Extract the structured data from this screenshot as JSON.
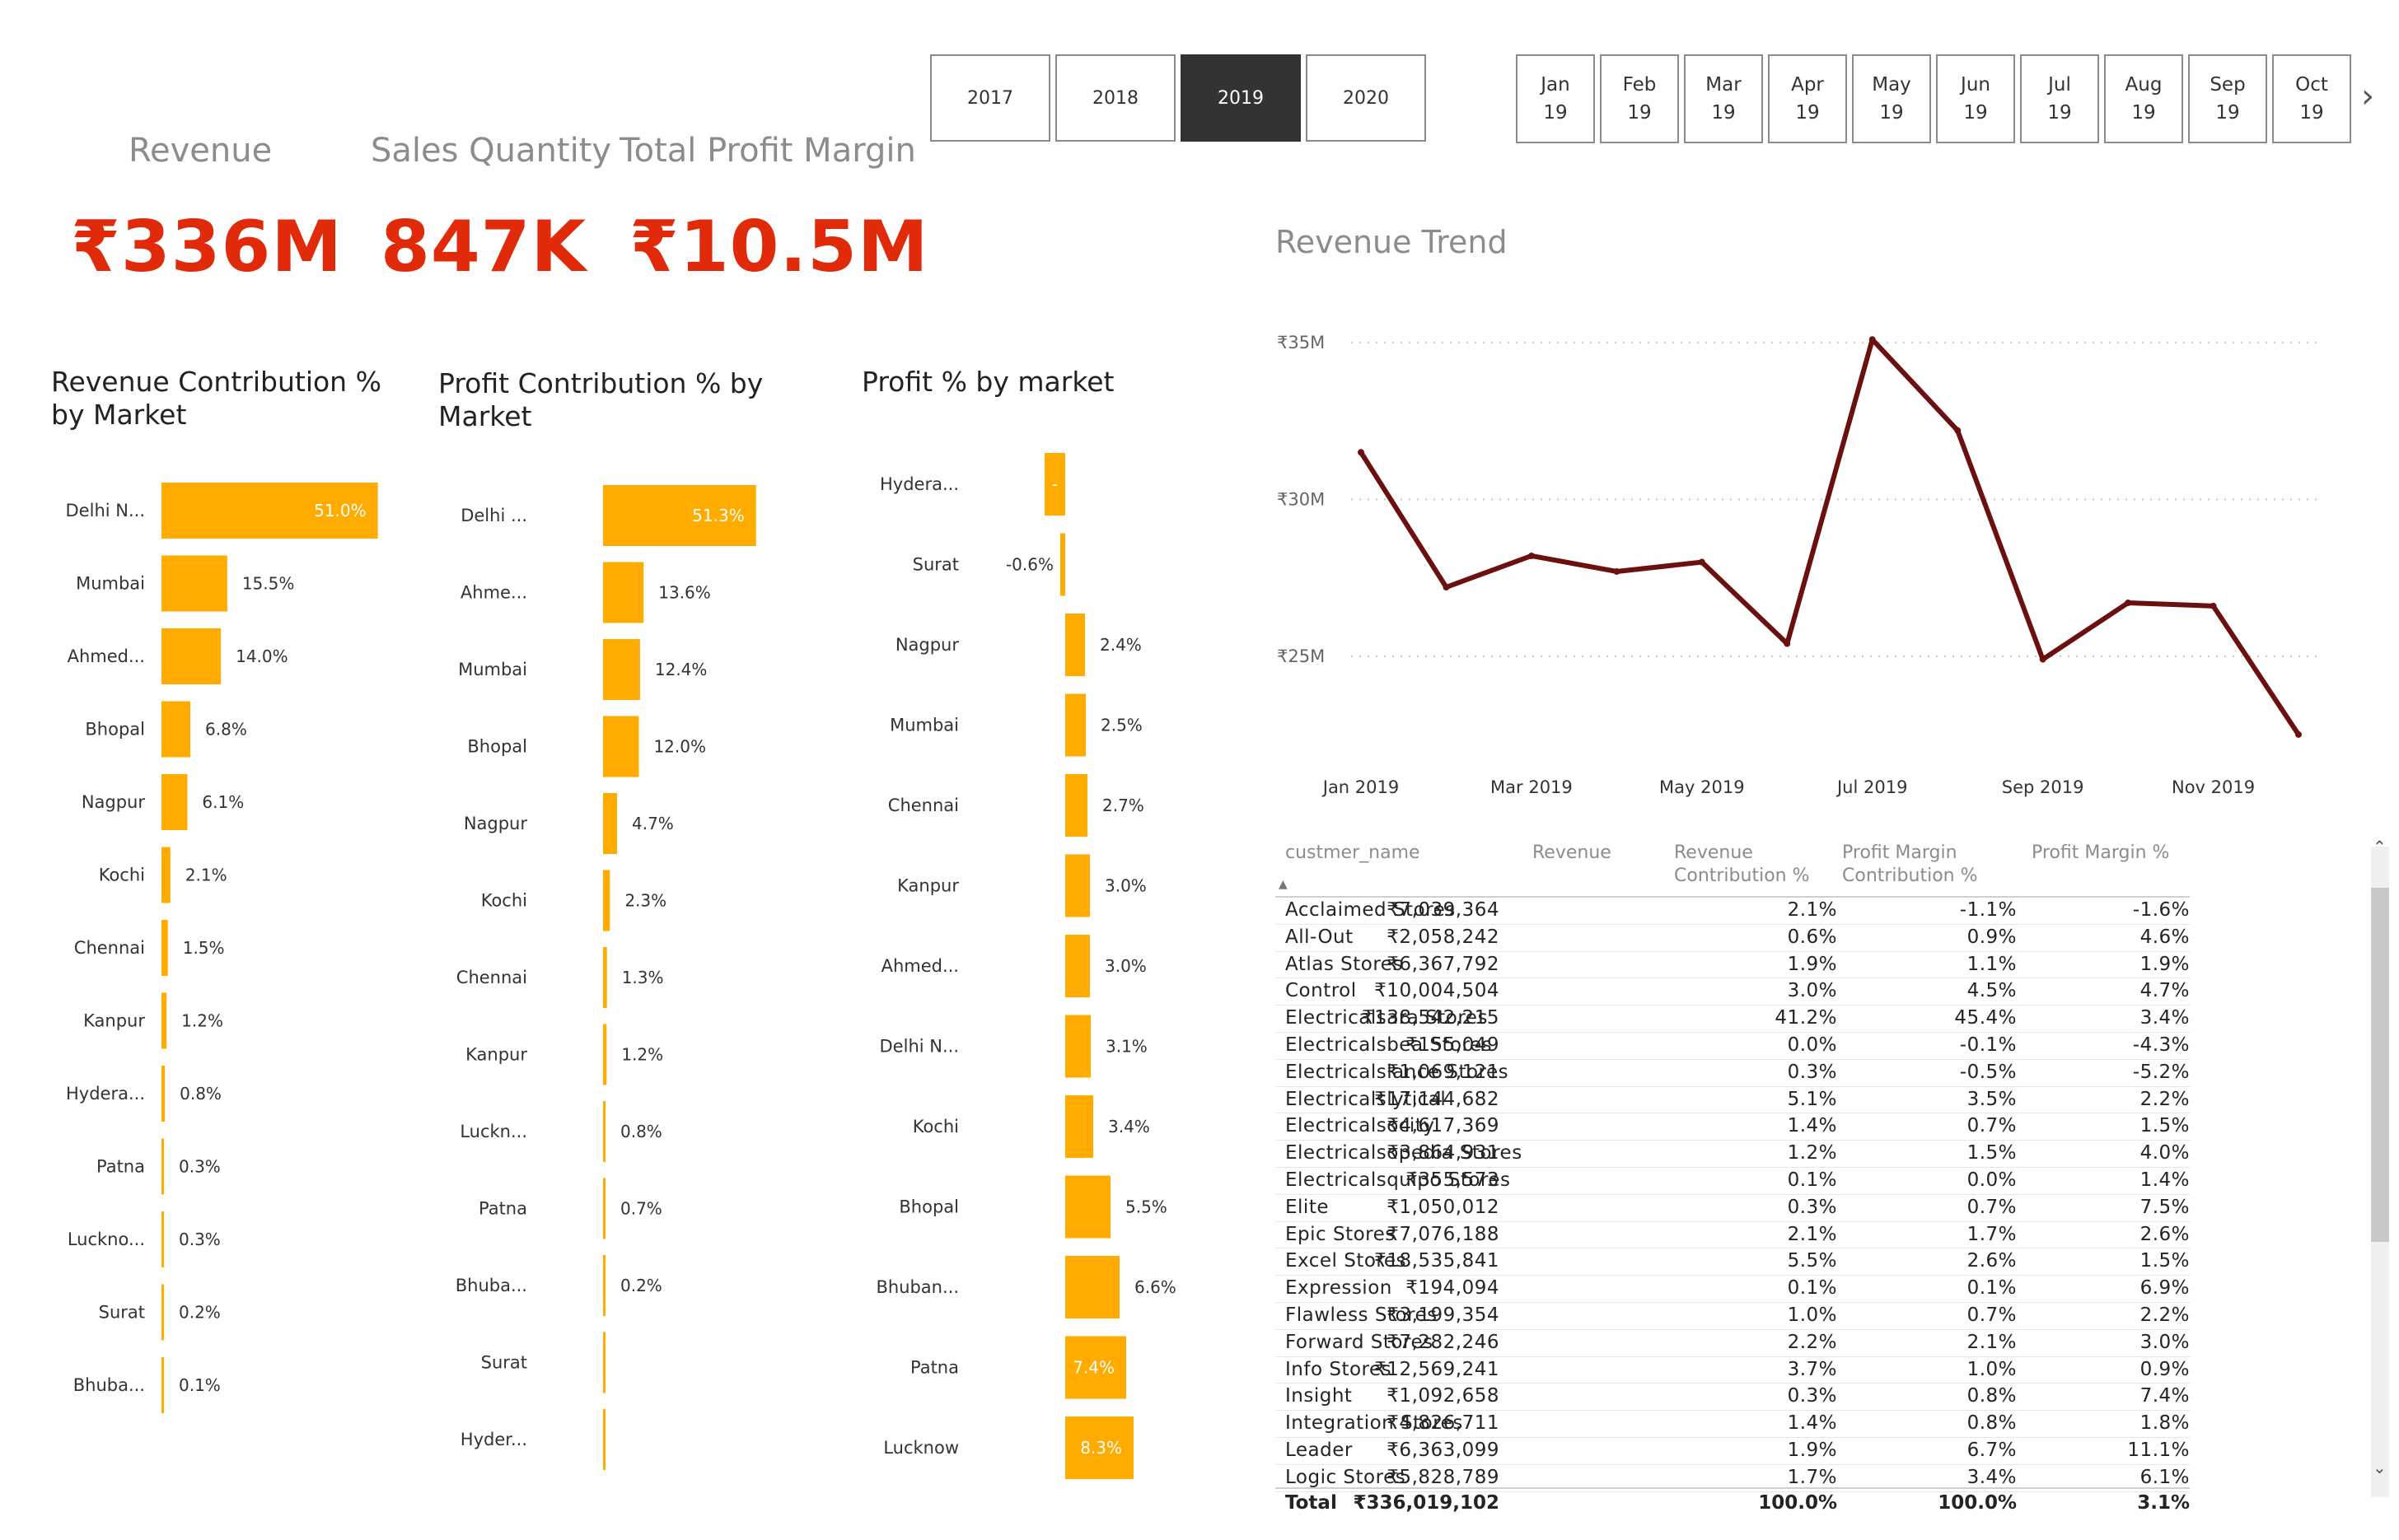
{
  "years": [
    {
      "label": "2017",
      "selected": false
    },
    {
      "label": "2018",
      "selected": false
    },
    {
      "label": "2019",
      "selected": true
    },
    {
      "label": "2020",
      "selected": false
    }
  ],
  "months": [
    {
      "m": "Jan",
      "y": "19"
    },
    {
      "m": "Feb",
      "y": "19"
    },
    {
      "m": "Mar",
      "y": "19"
    },
    {
      "m": "Apr",
      "y": "19"
    },
    {
      "m": "May",
      "y": "19"
    },
    {
      "m": "Jun",
      "y": "19"
    },
    {
      "m": "Jul",
      "y": "19"
    },
    {
      "m": "Aug",
      "y": "19"
    },
    {
      "m": "Sep",
      "y": "19"
    },
    {
      "m": "Oct",
      "y": "19"
    }
  ],
  "kpis": {
    "revenue_label": "Revenue",
    "revenue_value": "₹336M",
    "qty_label": "Sales Quantity",
    "qty_value": "847K",
    "margin_label": "Total Profit Margin",
    "margin_value": "₹10.5M"
  },
  "colors": {
    "bar": "#ffab00",
    "kpi": "#e12a0a",
    "trend": "#6b0f0f",
    "selected_year": "#333333"
  },
  "chart_data": [
    {
      "type": "bar",
      "orientation": "horizontal",
      "title": "Revenue Contribution % by Market",
      "categories": [
        "Delhi N...",
        "Mumbai",
        "Ahmed...",
        "Bhopal",
        "Nagpur",
        "Kochi",
        "Chennai",
        "Kanpur",
        "Hydera...",
        "Patna",
        "Luckno...",
        "Surat",
        "Bhuba..."
      ],
      "values": [
        51.0,
        15.5,
        14.0,
        6.8,
        6.1,
        2.1,
        1.5,
        1.2,
        0.8,
        0.3,
        0.3,
        0.2,
        0.1
      ],
      "labels": [
        "51.0%",
        "15.5%",
        "14.0%",
        "6.8%",
        "6.1%",
        "2.1%",
        "1.5%",
        "1.2%",
        "0.8%",
        "0.3%",
        "0.3%",
        "0.2%",
        "0.1%"
      ]
    },
    {
      "type": "bar",
      "orientation": "horizontal",
      "title": "Profit Contribution % by Market",
      "categories": [
        "Delhi ...",
        "Ahme...",
        "Mumbai",
        "Bhopal",
        "Nagpur",
        "Kochi",
        "Chennai",
        "Kanpur",
        "Luckn...",
        "Patna",
        "Bhuba...",
        "Surat",
        "Hyder..."
      ],
      "values": [
        51.3,
        13.6,
        12.4,
        12.0,
        4.7,
        2.3,
        1.3,
        1.2,
        0.8,
        0.7,
        0.2,
        0.0,
        0.0
      ],
      "labels": [
        "51.3%",
        "13.6%",
        "12.4%",
        "12.0%",
        "4.7%",
        "2.3%",
        "1.3%",
        "1.2%",
        "0.8%",
        "0.7%",
        "0.2%",
        "",
        ""
      ]
    },
    {
      "type": "bar",
      "orientation": "horizontal",
      "title": "Profit % by market",
      "categories": [
        "Hydera...",
        "Surat",
        "Nagpur",
        "Mumbai",
        "Chennai",
        "Kanpur",
        "Ahmed...",
        "Delhi N...",
        "Kochi",
        "Bhopal",
        "Bhuban...",
        "Patna",
        "Lucknow"
      ],
      "values": [
        -2.5,
        -0.6,
        2.4,
        2.5,
        2.7,
        3.0,
        3.0,
        3.1,
        3.4,
        5.5,
        6.6,
        7.4,
        8.3
      ],
      "labels": [
        "-",
        "-0.6%",
        "2.4%",
        "2.5%",
        "2.7%",
        "3.0%",
        "3.0%",
        "3.1%",
        "3.4%",
        "5.5%",
        "6.6%",
        "7.4%",
        "8.3%"
      ]
    },
    {
      "type": "line",
      "title": "Revenue Trend",
      "x": [
        "Jan 2019",
        "Feb 2019",
        "Mar 2019",
        "Apr 2019",
        "May 2019",
        "Jun 2019",
        "Jul 2019",
        "Aug 2019",
        "Sep 2019",
        "Oct 2019",
        "Nov 2019",
        "Dec 2019"
      ],
      "values": [
        31.5,
        27.2,
        28.2,
        27.7,
        28.0,
        25.4,
        35.1,
        32.2,
        24.9,
        26.7,
        26.6,
        22.5
      ],
      "unit": "₹M",
      "ylim": [
        21.5,
        36
      ],
      "yticks": [
        "₹25M",
        "₹30M",
        "₹35M"
      ],
      "ytick_values": [
        25,
        30,
        35
      ],
      "xticks": [
        "Jan 2019",
        "Mar 2019",
        "May 2019",
        "Jul 2019",
        "Sep 2019",
        "Nov 2019"
      ],
      "grid": true
    }
  ],
  "table": {
    "headers": {
      "name": "custmer_name",
      "revenue": "Revenue",
      "rev_contrib": "Revenue\nContribution %",
      "pm_contrib": "Profit Margin\nContribution %",
      "pm": "Profit Margin %"
    },
    "rows": [
      [
        "Acclaimed Stores",
        "₹7,039,364",
        "2.1%",
        "-1.1%",
        "-1.6%"
      ],
      [
        "All-Out",
        "₹2,058,242",
        "0.6%",
        "0.9%",
        "4.6%"
      ],
      [
        "Atlas Stores",
        "₹6,367,792",
        "1.9%",
        "1.1%",
        "1.9%"
      ],
      [
        "Control",
        "₹10,004,504",
        "3.0%",
        "4.5%",
        "4.7%"
      ],
      [
        "Electricalsara Stores",
        "₹138,542,215",
        "41.2%",
        "45.4%",
        "3.4%"
      ],
      [
        "Electricalsbea Stores",
        "₹155,049",
        "0.0%",
        "-0.1%",
        "-4.3%"
      ],
      [
        "Electricalslance Stores",
        "₹1,069,121",
        "0.3%",
        "-0.5%",
        "-5.2%"
      ],
      [
        "Electricalslytical",
        "₹17,144,682",
        "5.1%",
        "3.5%",
        "2.2%"
      ],
      [
        "Electricalsocity",
        "₹4,617,369",
        "1.4%",
        "0.7%",
        "1.5%"
      ],
      [
        "Electricalsopedia Stores",
        "₹3,864,931",
        "1.2%",
        "1.5%",
        "4.0%"
      ],
      [
        "Electricalsquipo Stores",
        "₹355,573",
        "0.1%",
        "0.0%",
        "1.4%"
      ],
      [
        "Elite",
        "₹1,050,012",
        "0.3%",
        "0.7%",
        "7.5%"
      ],
      [
        "Epic Stores",
        "₹7,076,188",
        "2.1%",
        "1.7%",
        "2.6%"
      ],
      [
        "Excel Stores",
        "₹18,535,841",
        "5.5%",
        "2.6%",
        "1.5%"
      ],
      [
        "Expression",
        "₹194,094",
        "0.1%",
        "0.1%",
        "6.9%"
      ],
      [
        "Flawless Stores",
        "₹3,199,354",
        "1.0%",
        "0.7%",
        "2.2%"
      ],
      [
        "Forward Stores",
        "₹7,282,246",
        "2.2%",
        "2.1%",
        "3.0%"
      ],
      [
        "Info Stores",
        "₹12,569,241",
        "3.7%",
        "1.0%",
        "0.9%"
      ],
      [
        "Insight",
        "₹1,092,658",
        "0.3%",
        "0.8%",
        "7.4%"
      ],
      [
        "Integration Stores",
        "₹4,826,711",
        "1.4%",
        "0.8%",
        "1.8%"
      ],
      [
        "Leader",
        "₹6,363,099",
        "1.9%",
        "6.7%",
        "11.1%"
      ],
      [
        "Logic Stores",
        "₹5,828,789",
        "1.7%",
        "3.4%",
        "6.1%"
      ]
    ],
    "total": [
      "Total",
      "₹336,019,102",
      "100.0%",
      "100.0%",
      "3.1%"
    ]
  }
}
